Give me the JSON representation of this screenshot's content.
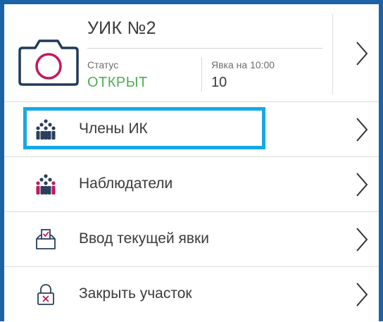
{
  "header": {
    "title": "УИК №2",
    "status_label": "Статус",
    "status_value": "ОТКРЫТ",
    "turnout_label": "Явка на 10:00",
    "turnout_value": "10"
  },
  "menu": [
    {
      "label": "Члены ИК",
      "icon": "people-group-icon"
    },
    {
      "label": "Наблюдатели",
      "icon": "observers-group-icon"
    },
    {
      "label": "Ввод текущей явки",
      "icon": "ballot-box-icon"
    },
    {
      "label": "Закрыть участок",
      "icon": "padlock-icon"
    }
  ],
  "colors": {
    "frame": "#1c63a6",
    "status_open": "#4caf50",
    "highlight": "#14a9e6",
    "camera_lens": "#c2185b",
    "camera_body": "#1f3a5a"
  }
}
